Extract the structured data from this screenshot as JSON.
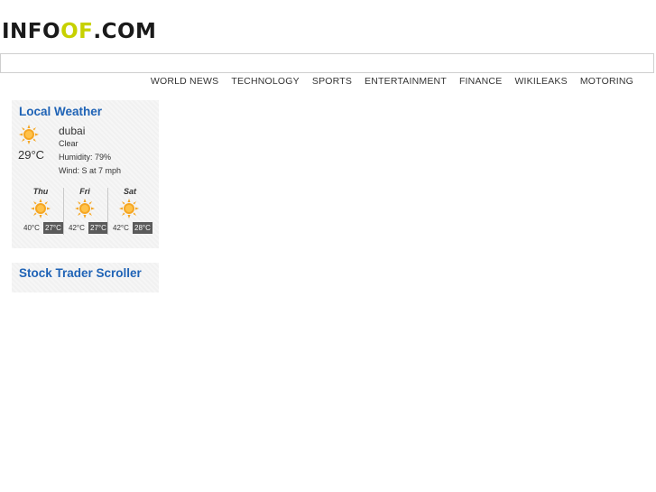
{
  "logo": {
    "part1": "INFO",
    "part2": "OF",
    "part3": ".COM"
  },
  "search": {
    "placeholder": ""
  },
  "nav": [
    "WORLD NEWS",
    "TECHNOLOGY",
    "SPORTS",
    "ENTERTAINMENT",
    "FINANCE",
    "WIKILEAKS",
    "MOTORING"
  ],
  "weather": {
    "title": "Local Weather",
    "current_temp": "29°C",
    "city": "dubai",
    "condition": "Clear",
    "humidity": "Humidity: 79%",
    "wind": "Wind: S at 7 mph",
    "icon": "sun-icon",
    "forecast": [
      {
        "day": "Thu",
        "high": "40°C",
        "low": "27°C",
        "icon": "sun-icon"
      },
      {
        "day": "Fri",
        "high": "42°C",
        "low": "27°C",
        "icon": "sun-icon"
      },
      {
        "day": "Sat",
        "high": "42°C",
        "low": "28°C",
        "icon": "sun-icon"
      }
    ]
  },
  "stock": {
    "title": "Stock Trader Scroller"
  },
  "colors": {
    "title_blue": "#1f63b6",
    "logo_accent": "#c7d100",
    "sun": "#f5a623"
  }
}
